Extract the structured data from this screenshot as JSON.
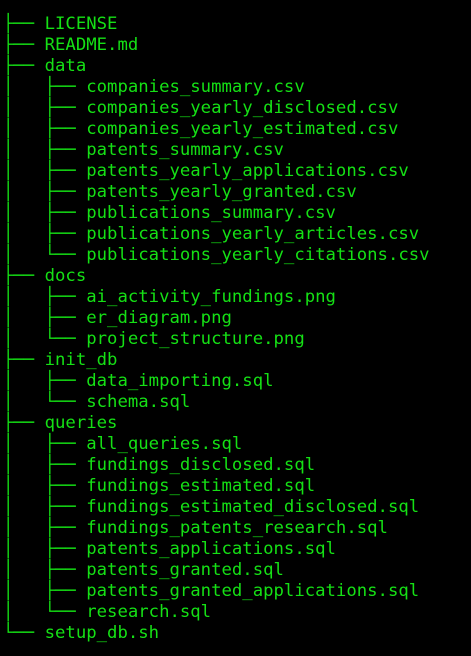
{
  "colors": {
    "background": "#000000",
    "text": "#15e015"
  },
  "tree": [
    {
      "prefix": "├── ",
      "name": "LICENSE"
    },
    {
      "prefix": "├── ",
      "name": "README.md"
    },
    {
      "prefix": "├── ",
      "name": "data"
    },
    {
      "prefix": "│   ├── ",
      "name": "companies_summary.csv"
    },
    {
      "prefix": "│   ├── ",
      "name": "companies_yearly_disclosed.csv"
    },
    {
      "prefix": "│   ├── ",
      "name": "companies_yearly_estimated.csv"
    },
    {
      "prefix": "│   ├── ",
      "name": "patents_summary.csv"
    },
    {
      "prefix": "│   ├── ",
      "name": "patents_yearly_applications.csv"
    },
    {
      "prefix": "│   ├── ",
      "name": "patents_yearly_granted.csv"
    },
    {
      "prefix": "│   ├── ",
      "name": "publications_summary.csv"
    },
    {
      "prefix": "│   ├── ",
      "name": "publications_yearly_articles.csv"
    },
    {
      "prefix": "│   └── ",
      "name": "publications_yearly_citations.csv"
    },
    {
      "prefix": "├── ",
      "name": "docs"
    },
    {
      "prefix": "│   ├── ",
      "name": "ai_activity_fundings.png"
    },
    {
      "prefix": "│   ├── ",
      "name": "er_diagram.png"
    },
    {
      "prefix": "│   └── ",
      "name": "project_structure.png"
    },
    {
      "prefix": "├── ",
      "name": "init_db"
    },
    {
      "prefix": "│   ├── ",
      "name": "data_importing.sql"
    },
    {
      "prefix": "│   └── ",
      "name": "schema.sql"
    },
    {
      "prefix": "├── ",
      "name": "queries"
    },
    {
      "prefix": "│   ├── ",
      "name": "all_queries.sql"
    },
    {
      "prefix": "│   ├── ",
      "name": "fundings_disclosed.sql"
    },
    {
      "prefix": "│   ├── ",
      "name": "fundings_estimated.sql"
    },
    {
      "prefix": "│   ├── ",
      "name": "fundings_estimated_disclosed.sql"
    },
    {
      "prefix": "│   ├── ",
      "name": "fundings_patents_research.sql"
    },
    {
      "prefix": "│   ├── ",
      "name": "patents_applications.sql"
    },
    {
      "prefix": "│   ├── ",
      "name": "patents_granted.sql"
    },
    {
      "prefix": "│   ├── ",
      "name": "patents_granted_applications.sql"
    },
    {
      "prefix": "│   └── ",
      "name": "research.sql"
    },
    {
      "prefix": "└── ",
      "name": "setup_db.sh"
    }
  ]
}
